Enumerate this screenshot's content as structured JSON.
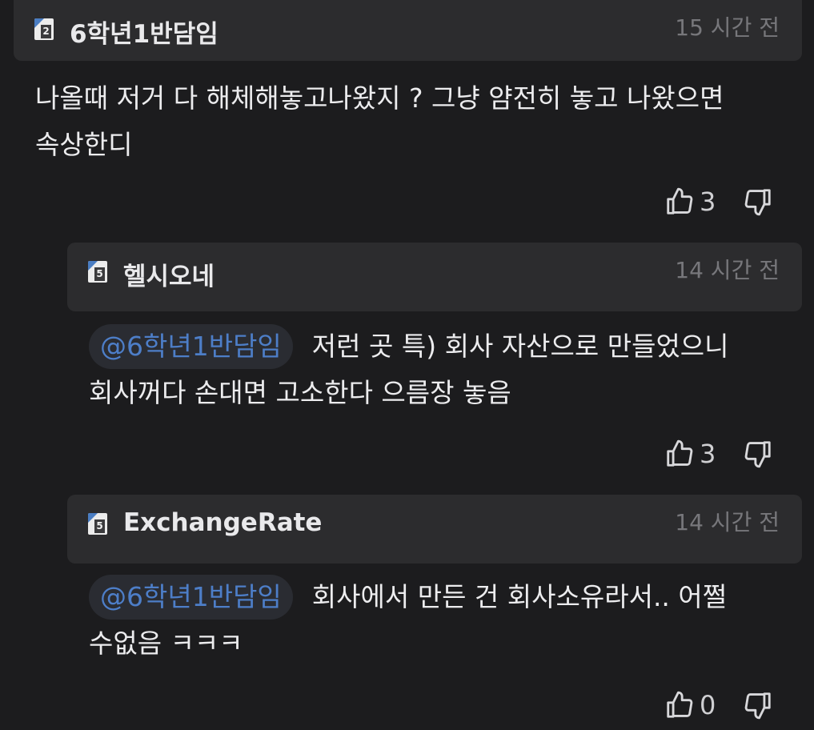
{
  "comments": [
    {
      "level": "2",
      "author": "6학년1반담임",
      "time": "15 시간 전",
      "lines": [
        "나올때 저거 다 해체해놓고나왔지 ? 그냥 얌전히 놓고 나왔으면",
        "속상한디"
      ],
      "likes": "3"
    },
    {
      "level": "5",
      "author": "헬시오네",
      "time": "14 시간 전",
      "mention": "@6학년1반담임",
      "lines": [
        "저런 곳 특) 회사 자산으로 만들었으니",
        "회사꺼다 손대면 고소한다 으름장 놓음"
      ],
      "likes": "3"
    },
    {
      "level": "5",
      "author": "ExchangeRate",
      "time": "14 시간 전",
      "mention": "@6학년1반담임",
      "lines": [
        "회사에서 만든 건 회사소유라서.. 어쩔",
        "수없음 ㅋㅋㅋ"
      ],
      "likes": "0"
    }
  ],
  "icons": {
    "like": "thumbs-up-icon",
    "dislike": "thumbs-down-icon",
    "level": "level-badge-icon"
  },
  "colors": {
    "background": "#1c1c1e",
    "header": "#2c2c2e",
    "mention": "#4d7ec8",
    "badge_accent": "#4a7dc2"
  }
}
